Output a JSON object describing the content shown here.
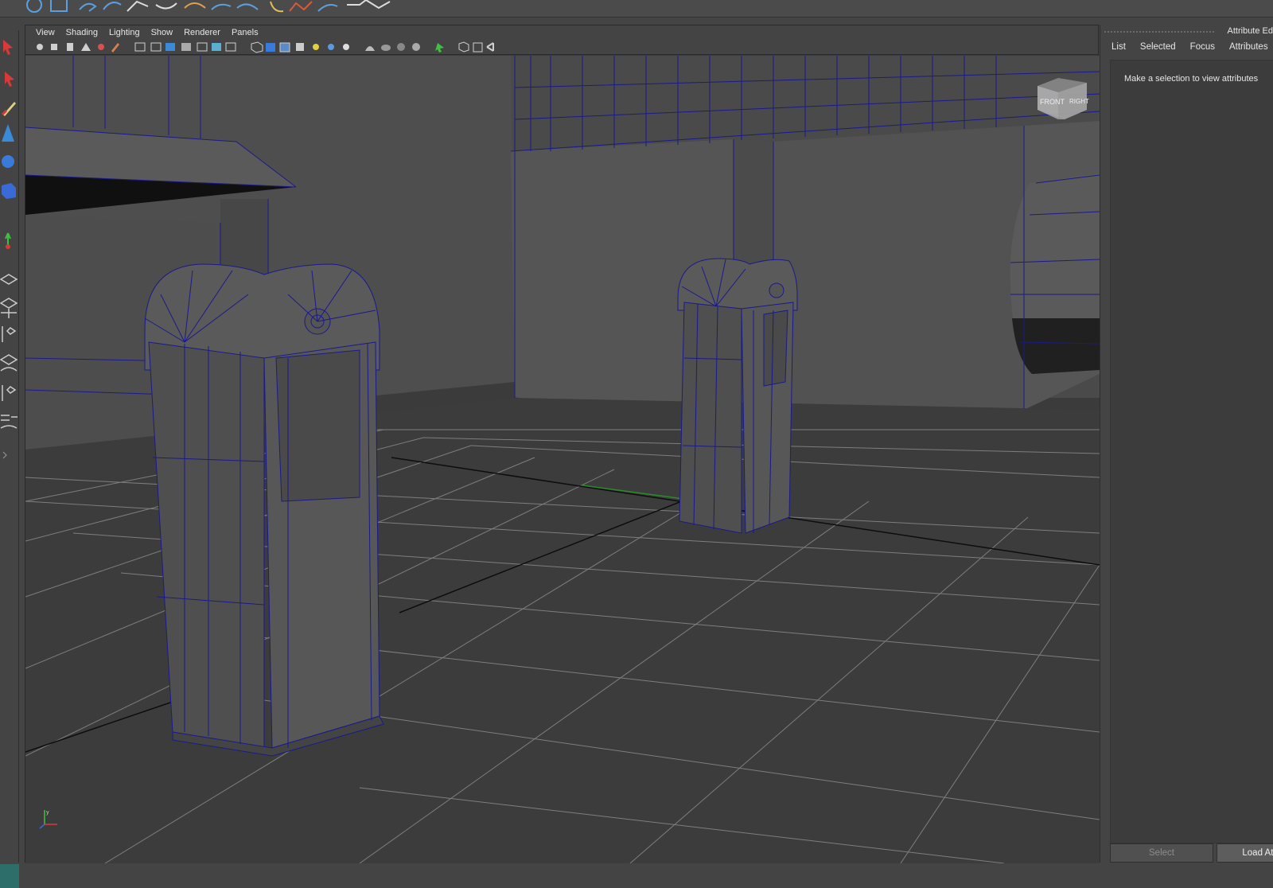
{
  "panel_menu": {
    "view": "View",
    "shading": "Shading",
    "lighting": "Lighting",
    "show": "Show",
    "renderer": "Renderer",
    "panels": "Panels"
  },
  "viewcube": {
    "front": "FRONT",
    "right": "RIGHT"
  },
  "attribute_editor": {
    "title": "Attribute Ed",
    "tabs": [
      "List",
      "Selected",
      "Focus",
      "Attributes"
    ],
    "message": "Make a selection to view attributes",
    "select_label": "Select",
    "load_label": "Load Att"
  },
  "colors": {
    "wireframe": "#1a1a8c",
    "grid": "#8a8a8a",
    "background": "#3a3a3a",
    "geometry": "#565656"
  },
  "icons": [
    "move-icon",
    "select-icon",
    "paint-icon",
    "cone-icon",
    "sphere-icon",
    "cube-icon",
    "axis-icon",
    "layout-icon"
  ]
}
